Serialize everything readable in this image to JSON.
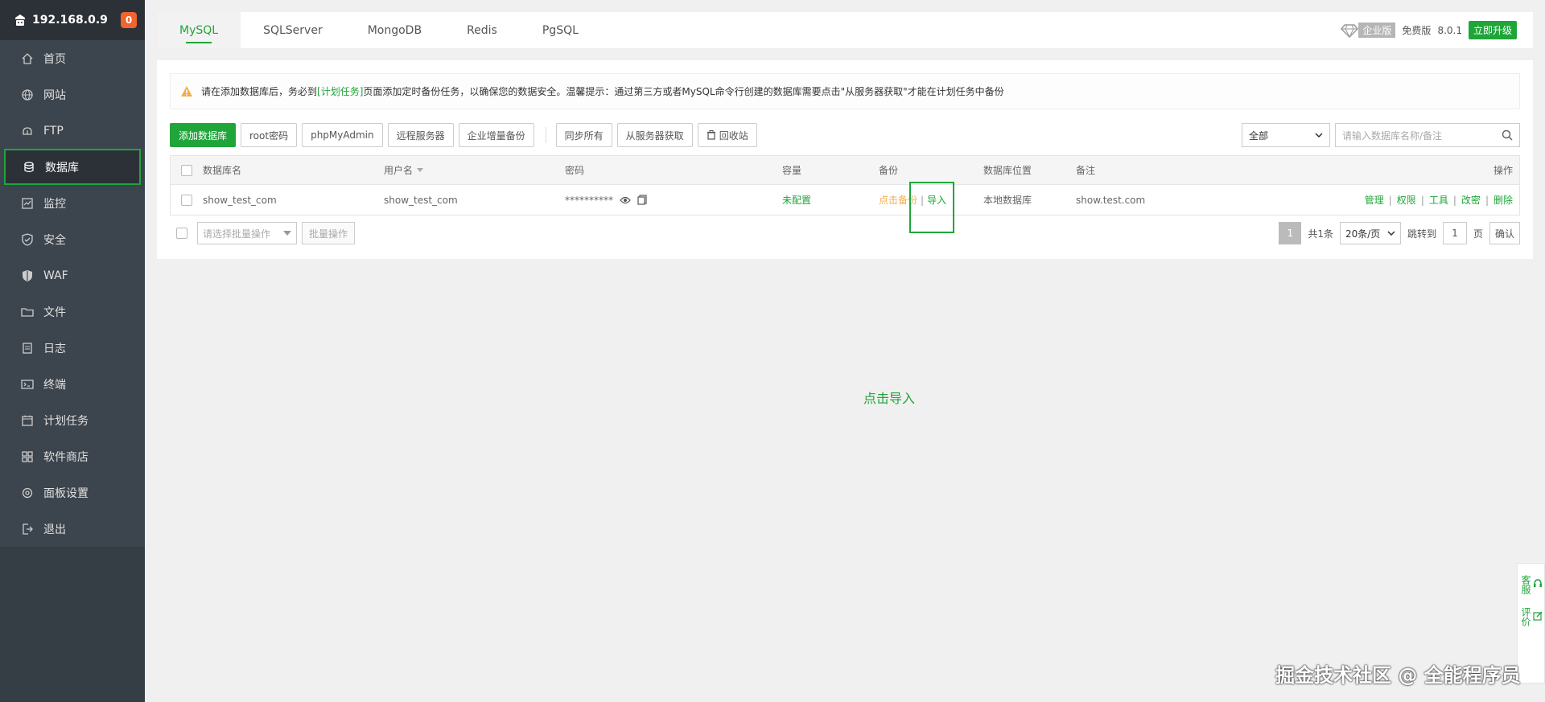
{
  "sidebar": {
    "server_ip": "192.168.0.9",
    "badge_count": "0",
    "items": [
      {
        "label": "首页",
        "icon": "home-icon"
      },
      {
        "label": "网站",
        "icon": "globe-icon"
      },
      {
        "label": "FTP",
        "icon": "ftp-icon"
      },
      {
        "label": "数据库",
        "icon": "database-icon"
      },
      {
        "label": "监控",
        "icon": "monitor-icon"
      },
      {
        "label": "安全",
        "icon": "shield-icon"
      },
      {
        "label": "WAF",
        "icon": "waf-icon"
      },
      {
        "label": "文件",
        "icon": "folder-icon"
      },
      {
        "label": "日志",
        "icon": "log-icon"
      },
      {
        "label": "终端",
        "icon": "terminal-icon"
      },
      {
        "label": "计划任务",
        "icon": "calendar-icon"
      },
      {
        "label": "软件商店",
        "icon": "store-icon"
      },
      {
        "label": "面板设置",
        "icon": "settings-icon"
      },
      {
        "label": "退出",
        "icon": "logout-icon"
      }
    ],
    "active_index": 3
  },
  "tabs": [
    "MySQL",
    "SQLServer",
    "MongoDB",
    "Redis",
    "PgSQL"
  ],
  "topright": {
    "edition": "企业版",
    "free_edition": "免费版",
    "version": "8.0.1",
    "upgrade": "立即升级"
  },
  "alert": {
    "text_before": "请在添加数据库后，务必到",
    "link": "[计划任务]",
    "text_after": "页面添加定时备份任务，以确保您的数据安全。温馨提示：通过第三方或者MySQL命令行创建的数据库需要点击\"从服务器获取\"才能在计划任务中备份"
  },
  "toolbar": {
    "add_db": "添加数据库",
    "root_pwd": "root密码",
    "phpmyadmin": "phpMyAdmin",
    "remote_server": "远程服务器",
    "enterprise_backup": "企业增量备份",
    "sync_all": "同步所有",
    "fetch_from_server": "从服务器获取",
    "recycle_bin": "回收站",
    "filter_value": "全部",
    "search_placeholder": "请输入数据库名称/备注"
  },
  "table": {
    "headers": {
      "name": "数据库名",
      "user": "用户名",
      "password": "密码",
      "capacity": "容量",
      "backup": "备份",
      "location": "数据库位置",
      "note": "备注",
      "ops": "操作"
    },
    "rows": [
      {
        "name": "show_test_com",
        "user": "show_test_com",
        "password": "**********",
        "capacity": "未配置",
        "backup_click": "点击备份",
        "backup_sep": "|",
        "import": "导入",
        "location": "本地数据库",
        "note": "show.test.com",
        "ops": [
          "管理",
          "权限",
          "工具",
          "改密",
          "删除"
        ]
      }
    ]
  },
  "footer": {
    "batch_placeholder": "请选择批量操作",
    "batch_button": "批量操作",
    "page": "1",
    "total": "共1条",
    "per_page": "20条/页",
    "jump_label": "跳转到",
    "jump_value": "1",
    "page_unit": "页",
    "confirm": "确认"
  },
  "caption": "点击导入",
  "float": {
    "service": "客服",
    "review": "评价"
  },
  "watermark": "掘金技术社区 @ 全能程序员",
  "colors": {
    "accent": "#20a53a",
    "sidebar": "#3c444d",
    "badge": "#f0642d",
    "warning": "#f0ad4e"
  }
}
